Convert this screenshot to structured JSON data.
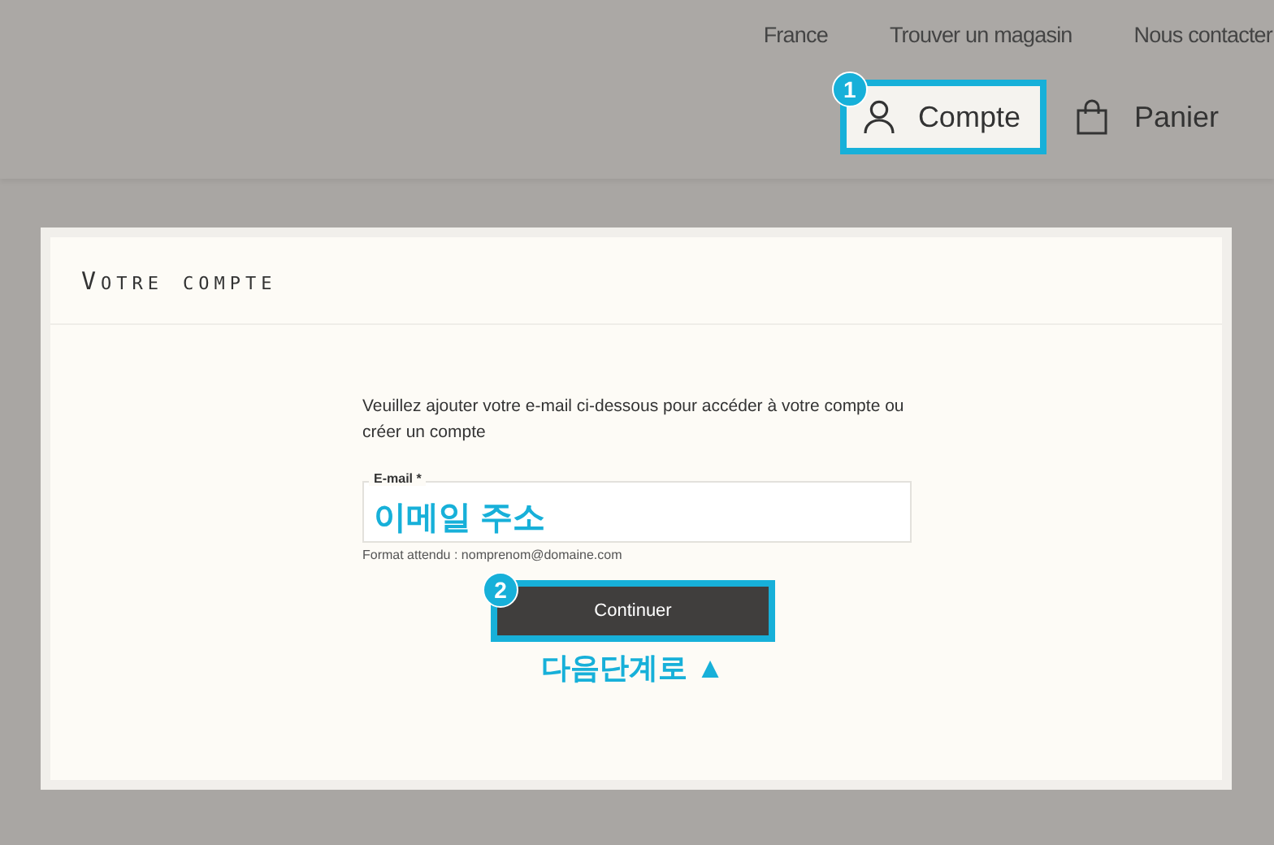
{
  "header": {
    "top_links": [
      "France",
      "Trouver un magasin",
      "Nous contacter"
    ],
    "account": {
      "label": "Compte",
      "highlighted": true,
      "step": "1"
    },
    "cart": {
      "label": "Panier"
    }
  },
  "card": {
    "title": "Votre compte",
    "intro": "Veuillez ajouter votre e-mail ci-dessous pour accéder à votre compte ou créer un compte",
    "email_field": {
      "label": "E-mail *",
      "value": "이메일 주소",
      "hint": "Format attendu : nomprenom@domaine.com"
    },
    "continue_button": {
      "label": "Continuer",
      "highlighted": true,
      "step": "2"
    },
    "caption": "다음단계로 ▲"
  }
}
